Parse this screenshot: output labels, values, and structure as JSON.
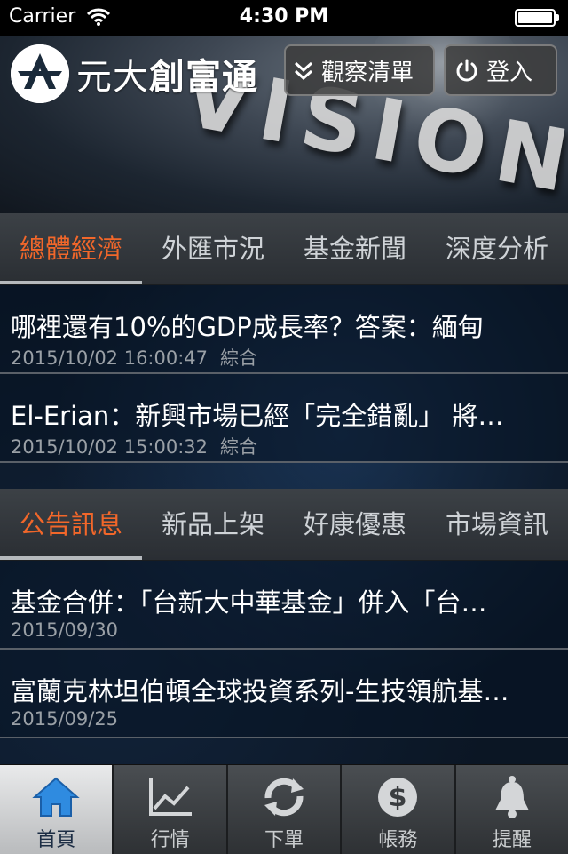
{
  "status_bar": {
    "carrier": "Carrier",
    "time": "4:30 PM"
  },
  "header": {
    "brand": {
      "part1": "元大",
      "part2": "創富通"
    },
    "hero_text": "VISION",
    "watchlist_label": "觀察清單",
    "login_label": "登入"
  },
  "news": {
    "tabs": [
      {
        "label": "總體經濟",
        "active": true
      },
      {
        "label": "外匯市況",
        "active": false
      },
      {
        "label": "基金新聞",
        "active": false
      },
      {
        "label": "深度分析",
        "active": false
      }
    ],
    "items": [
      {
        "title": "哪裡還有10%的GDP成長率？答案：緬甸",
        "datetime": "2015/10/02 16:00:47",
        "category": "綜合"
      },
      {
        "title": "El-Erian：新興市場已經「完全錯亂」 將…",
        "datetime": "2015/10/02 15:00:32",
        "category": "綜合"
      }
    ]
  },
  "notices": {
    "tabs": [
      {
        "label": "公告訊息",
        "active": true
      },
      {
        "label": "新品上架",
        "active": false
      },
      {
        "label": "好康優惠",
        "active": false
      },
      {
        "label": "市場資訊",
        "active": false
      }
    ],
    "items": [
      {
        "title": "基金合併：「台新大中華基金」併入「台…",
        "date": "2015/09/30"
      },
      {
        "title": "富蘭克林坦伯頓全球投資系列-生技領航基…",
        "date": "2015/09/25"
      }
    ]
  },
  "toolbar": {
    "items": [
      {
        "label": "首頁",
        "icon": "home-icon",
        "active": true
      },
      {
        "label": "行情",
        "icon": "chart-icon",
        "active": false
      },
      {
        "label": "下單",
        "icon": "refresh-icon",
        "active": false
      },
      {
        "label": "帳務",
        "icon": "dollar-icon",
        "active": false
      },
      {
        "label": "提醒",
        "icon": "bell-icon",
        "active": false
      }
    ]
  },
  "colors": {
    "accent": "#f2672a",
    "active_toolbar_icon": "#2f8be0"
  }
}
